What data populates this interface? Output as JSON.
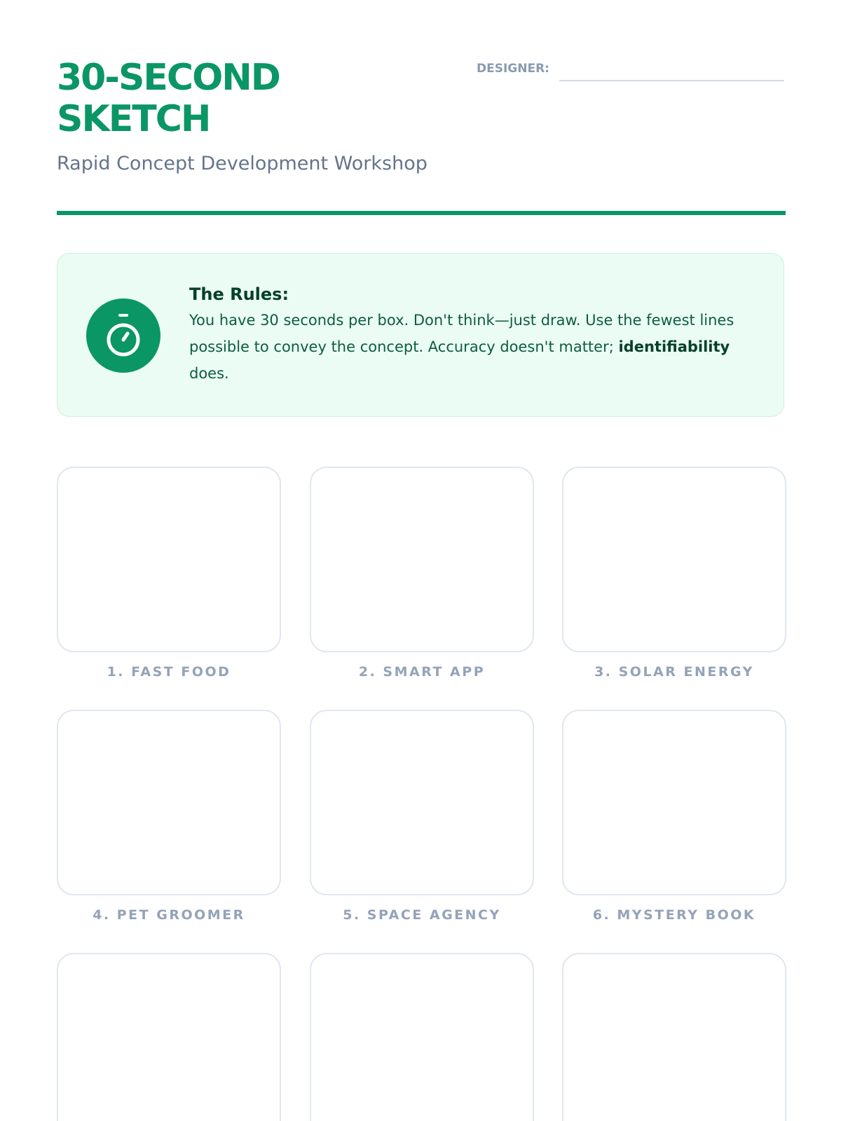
{
  "header": {
    "title": "30-SECOND SKETCH",
    "subtitle": "Rapid Concept Development Workshop",
    "designer_label": "DESIGNER:"
  },
  "rules": {
    "icon": "stopwatch-icon",
    "heading": "The Rules:",
    "body_text": "You have 30 seconds per box. Don't think—just draw. Use the fewest lines possible to convey the concept. Accuracy doesn't matter;",
    "emphasis": "identifiability",
    "body_end": " does."
  },
  "prompts": [
    {
      "label": "1. FAST FOOD"
    },
    {
      "label": "2. SMART APP"
    },
    {
      "label": "3. SOLAR ENERGY"
    },
    {
      "label": "4. PET GROOMER"
    },
    {
      "label": "5. SPACE AGENCY"
    },
    {
      "label": "6. MYSTERY BOOK"
    },
    {
      "label": ""
    },
    {
      "label": ""
    },
    {
      "label": ""
    }
  ],
  "colors": {
    "accent": "#0a9665",
    "rules_background": "#eafcf3",
    "label_gray": "#94a3b8"
  }
}
